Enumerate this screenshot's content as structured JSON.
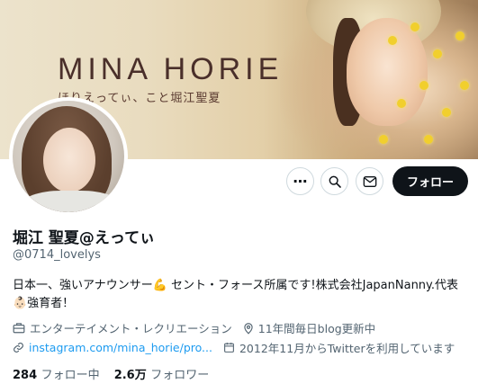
{
  "banner": {
    "title": "MINA HORIE",
    "subtitle": "ほりえってぃ、こと堀江聖夏"
  },
  "actions": {
    "more_label": "⋯",
    "follow_label": "フォロー"
  },
  "profile": {
    "name": "堀江 聖夏@えってぃ",
    "handle": "@0714_lovelys",
    "bio_line1": "日本一、強いアナウンサー💪 セント・フォース所属です!株式会社JapanNanny.代表",
    "bio_line2": "👶🏻強育者！",
    "category": "エンターテイメント・レクリエーション",
    "location": "11年間毎日blog更新中",
    "website": "instagram.com/mina_horie/pro...",
    "joined": "2012年11月からTwitterを利用しています"
  },
  "stats": {
    "following_count": "284",
    "following_label": "フォロー中",
    "followers_count": "2.6万",
    "followers_label": "フォロワー"
  },
  "colors": {
    "accent": "#1d9bf0",
    "text": "#0f1419",
    "muted": "#536471",
    "border": "#cfd9de"
  }
}
